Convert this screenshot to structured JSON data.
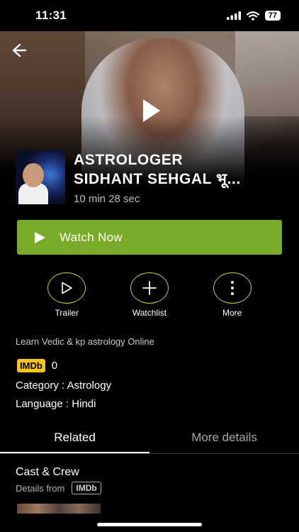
{
  "status_bar": {
    "time": "11:31",
    "battery": "77"
  },
  "hero": {
    "back_icon": "arrow-left-icon",
    "play_icon": "play-icon"
  },
  "program": {
    "title_line1": "ASTROLOGER",
    "title_line2": "SIDHANT SEHGAL भू...",
    "duration": "10 min 28 sec"
  },
  "watch_button": {
    "label": "Watch Now",
    "icon": "play-icon",
    "color": "#7aab28"
  },
  "actions": [
    {
      "label": "Trailer",
      "icon": "play-outline-icon"
    },
    {
      "label": "Watchlist",
      "icon": "plus-icon"
    },
    {
      "label": "More",
      "icon": "more-vertical-icon"
    }
  ],
  "accent_color": "#b7d23a",
  "info": {
    "description": "Learn Vedic & kp astrology Online",
    "imdb_badge": "IMDb",
    "imdb_rating": "0",
    "category": "Category : Astrology",
    "language": "Language : Hindi"
  },
  "tabs": [
    {
      "label": "Related",
      "active": true
    },
    {
      "label": "More details",
      "active": false
    }
  ],
  "cast": {
    "title": "Cast & Crew",
    "details_from": "Details from",
    "imdb_label": "IMDb"
  }
}
